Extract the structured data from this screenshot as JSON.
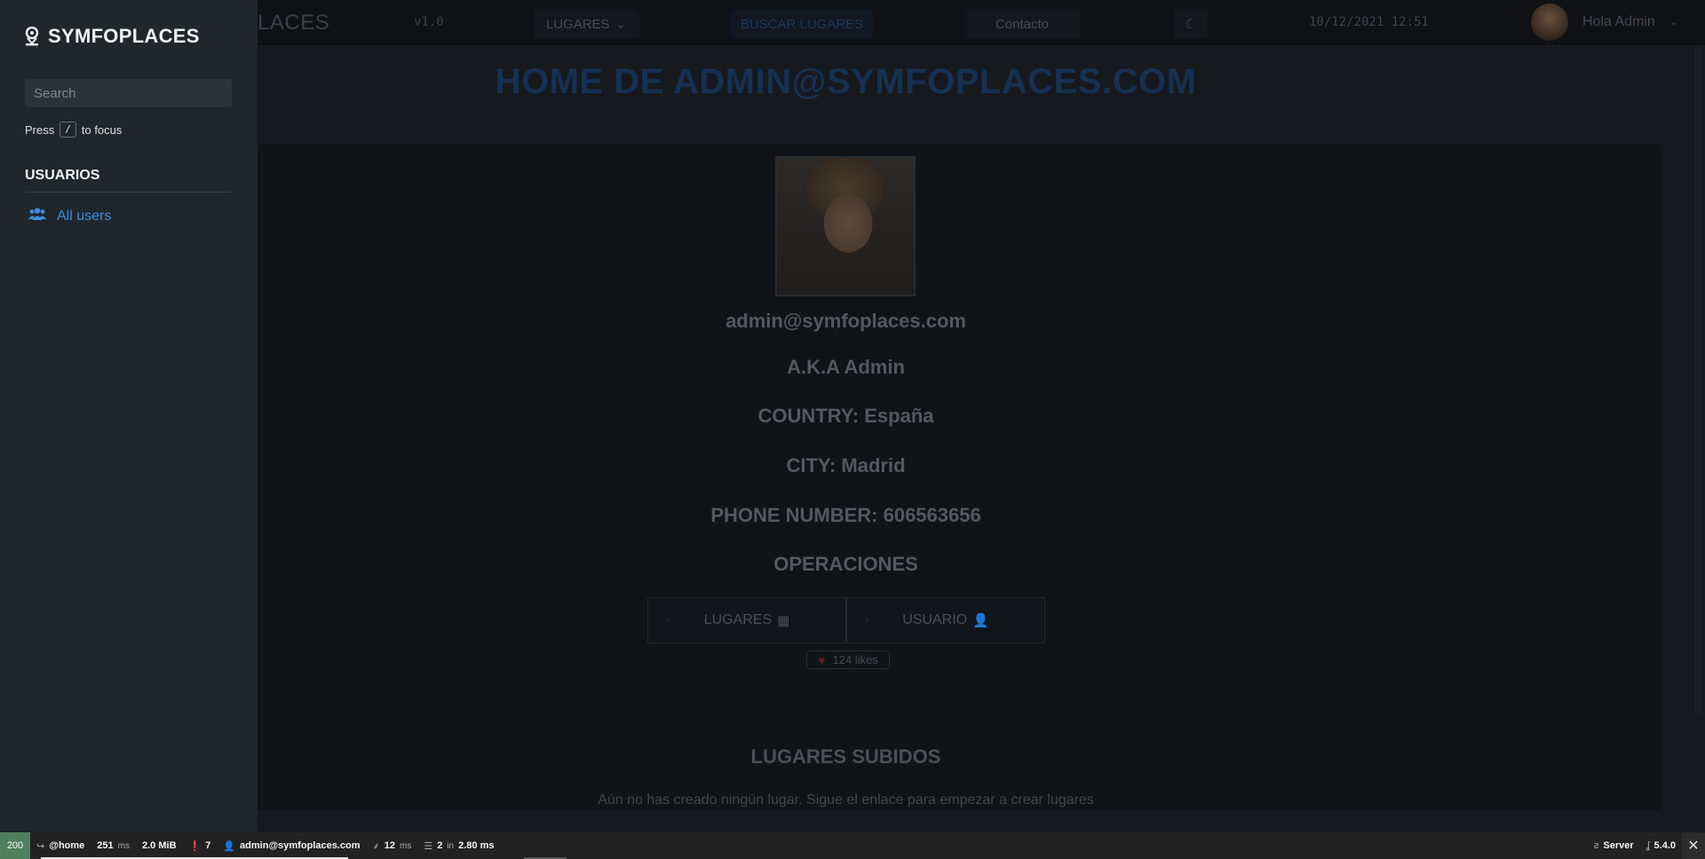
{
  "topnav": {
    "brand_partial": "LACES",
    "version": "v1.0",
    "lugares_label": "LUGARES",
    "buscar_label": "BUSCAR LUGARES",
    "contacto_label": "Contacto",
    "theme_icon": "moon-icon",
    "datetime": "10/12/2021 12:51",
    "greeting": "Hola Admin"
  },
  "page": {
    "title": "HOME DE ADMIN@SYMFOPLACES.COM",
    "email": "admin@symfoplaces.com",
    "aka": "A.K.A Admin",
    "country": "COUNTRY: España",
    "city": "CITY: Madrid",
    "phone": "PHONE NUMBER: 606563656",
    "operations_title": "OPERACIONES",
    "op_lugares": "LUGARES",
    "op_usuario": "USUARIO",
    "likes": "124 likes",
    "uploaded_title": "LUGARES SUBIDOS",
    "uploaded_empty": "Aún no has creado ningún lugar. Sigue el enlace para empezar a crear lugares"
  },
  "sidebar": {
    "brand": "SYMFOPLACES",
    "search_placeholder": "Search",
    "hint_prefix": "Press",
    "hint_key": "/",
    "hint_suffix": "to focus",
    "section": "USUARIOS",
    "items": [
      {
        "label": "All users",
        "icon": "users-icon"
      }
    ]
  },
  "debug_toolbar": {
    "status": "200",
    "route": "@home",
    "time_value": "251",
    "time_unit": "ms",
    "memory": "2.0 MiB",
    "logs_count": "7",
    "user": "admin@symfoplaces.com",
    "twig_value": "12",
    "twig_unit": "ms",
    "db_queries": "2",
    "db_in": "in",
    "db_time": "2.80 ms",
    "server_label": "Server",
    "version": "5.4.0"
  }
}
